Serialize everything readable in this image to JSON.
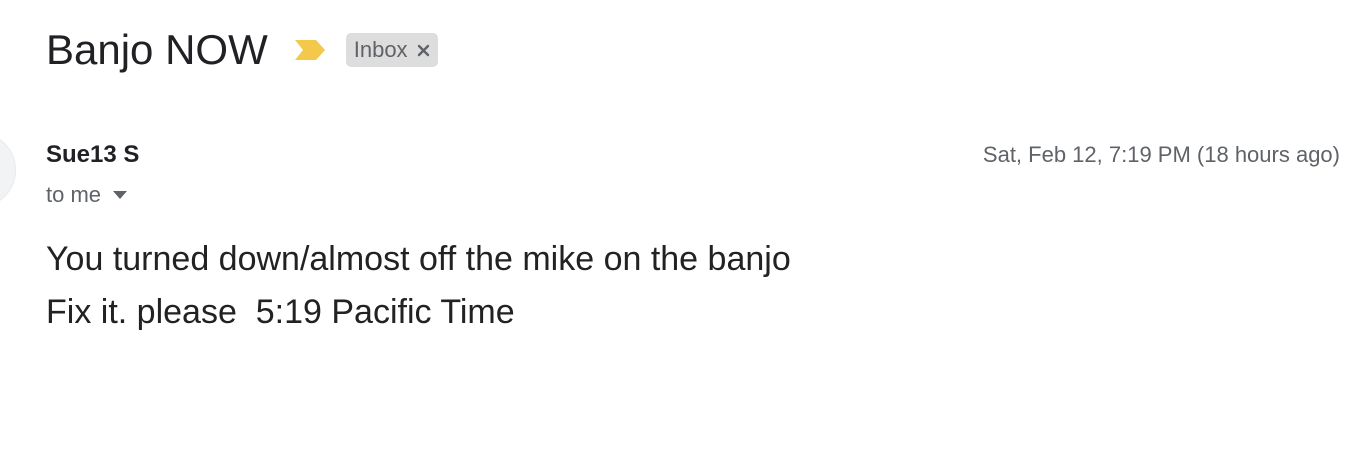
{
  "email": {
    "subject": "Banjo NOW",
    "label": "Inbox",
    "sender": "Sue13 S",
    "recipient": "to me",
    "timestamp": "Sat, Feb 12, 7:19 PM (18 hours ago)",
    "body_lines": [
      "You turned down/almost off the mike on the banjo",
      "Fix it. please  5:19 Pacific Time"
    ]
  },
  "icons": {
    "importance": "importance-marker-icon",
    "label_close": "close-icon",
    "recipient_details": "caret-down-icon"
  },
  "colors": {
    "importance": "#f4c84a",
    "chip_background": "#dddddd",
    "secondary_text": "#5f6368",
    "primary_text": "#202124"
  }
}
